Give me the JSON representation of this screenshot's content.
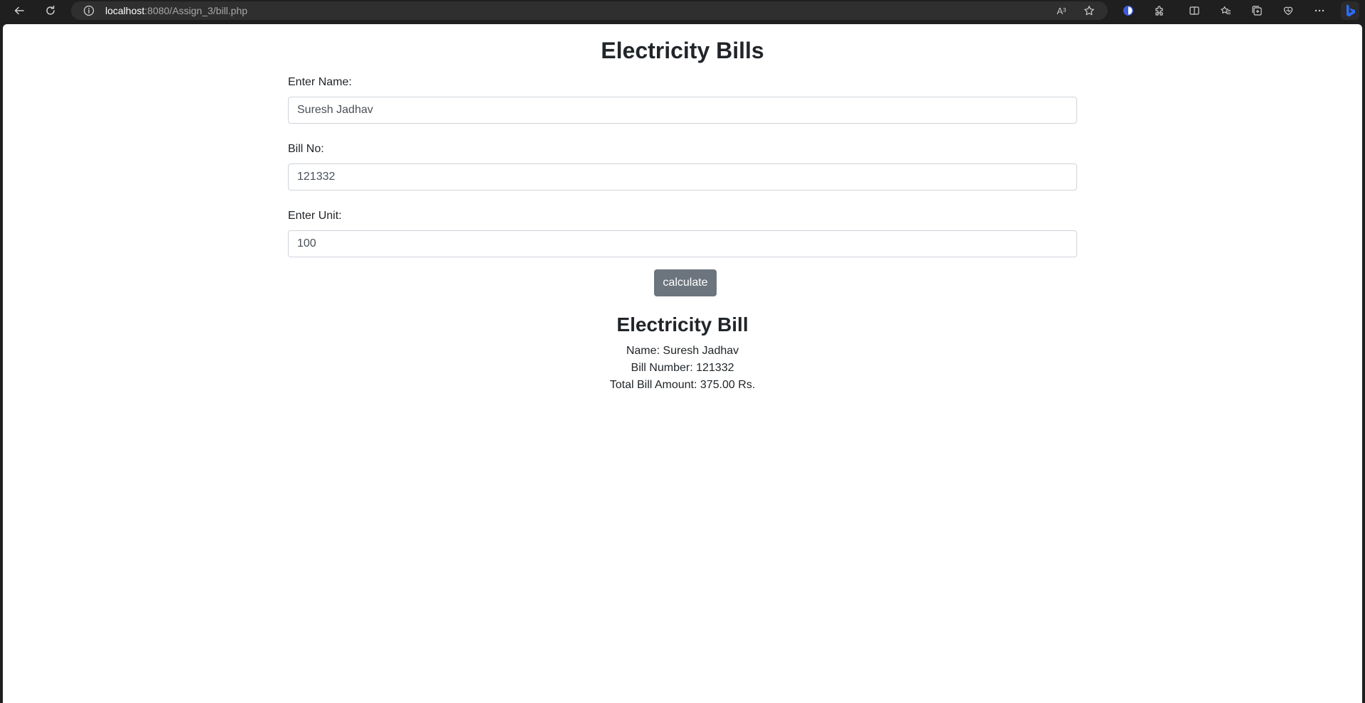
{
  "browser": {
    "url_host": "localhost",
    "url_rest": ":8080/Assign_3/bill.php",
    "read_aloud_label": "A³"
  },
  "page": {
    "title": "Electricity Bills",
    "form": {
      "name_label": "Enter Name:",
      "name_value": "Suresh Jadhav",
      "bill_label": "Bill No:",
      "bill_value": "121332",
      "unit_label": "Enter Unit:",
      "unit_value": "100",
      "submit_label": "calculate"
    },
    "result": {
      "heading": "Electricity Bill",
      "name_line": "Name: Suresh Jadhav",
      "bill_line": "Bill Number: 121332",
      "total_line": "Total Bill Amount: 375.00 Rs."
    }
  },
  "colors": {
    "chrome_bg": "#1f1f1f",
    "address_bg": "#2f2f2f",
    "button_bg": "#6c757d",
    "text": "#212529",
    "bing_accent": "#2f6cf6"
  }
}
